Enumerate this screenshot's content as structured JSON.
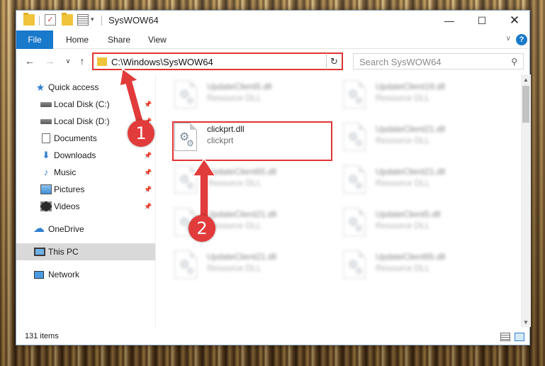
{
  "window": {
    "title": "SysWOW64"
  },
  "ribbon": {
    "file": "File",
    "tabs": [
      "Home",
      "Share",
      "View"
    ]
  },
  "address": {
    "path": "C:\\Windows\\SysWOW64"
  },
  "search": {
    "placeholder": "Search SysWOW64"
  },
  "sidebar": {
    "items": [
      {
        "label": "Quick access",
        "icon": "star-icon"
      },
      {
        "label": "Local Disk (C:)",
        "icon": "drive-icon",
        "pinned": true
      },
      {
        "label": "Local Disk (D:)",
        "icon": "drive-icon",
        "pinned": true
      },
      {
        "label": "Documents",
        "icon": "documents-icon",
        "pinned": true
      },
      {
        "label": "Downloads",
        "icon": "download-icon",
        "pinned": true
      },
      {
        "label": "Music",
        "icon": "music-icon",
        "pinned": true
      },
      {
        "label": "Pictures",
        "icon": "pictures-icon",
        "pinned": true
      },
      {
        "label": "Videos",
        "icon": "videos-icon",
        "pinned": true
      },
      {
        "label": "OneDrive",
        "icon": "cloud-icon"
      },
      {
        "label": "This PC",
        "icon": "computer-icon",
        "selected": true
      },
      {
        "label": "Network",
        "icon": "network-icon"
      }
    ]
  },
  "files": [
    {
      "name": "UpdateClient5.dll",
      "desc": "Resource DLL"
    },
    {
      "name": "UpdateClient19.dll",
      "desc": "Resource DLL"
    },
    {
      "name": "clickprt.dll",
      "desc": "clickprt"
    },
    {
      "name": "UpdateClient21.dll",
      "desc": "Resource DLL"
    },
    {
      "name": "UpdateClient65.dll",
      "desc": "Resource DLL"
    },
    {
      "name": "UpdateClient21.dll",
      "desc": "Resource DLL"
    },
    {
      "name": "UpdateClient21.dll",
      "desc": "Resource DLL"
    },
    {
      "name": "UpdateClient5.dll",
      "desc": "Resource DLL"
    },
    {
      "name": "UpdateClient21.dll",
      "desc": "Resource DLL"
    },
    {
      "name": "UpdateClient65.dll",
      "desc": "Resource DLL"
    }
  ],
  "status": {
    "count": "131 items"
  },
  "annotations": {
    "step1": "1",
    "step2": "2"
  },
  "colors": {
    "accent": "#1979ca",
    "highlight": "#e03434"
  }
}
